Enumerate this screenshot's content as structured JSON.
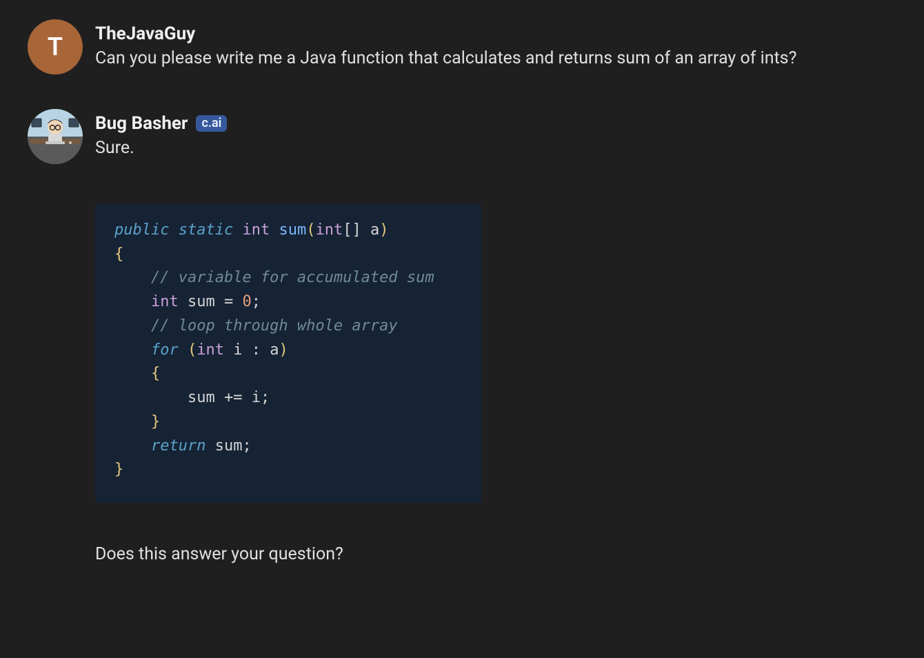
{
  "messages": [
    {
      "avatar_letter": "T",
      "username": "TheJavaGuy",
      "text": "Can you please write me a Java function that calculates and returns sum of an array of ints?"
    },
    {
      "username": "Bug Basher",
      "badge": "c.ai",
      "text_intro": "Sure.",
      "code": {
        "line1_kw1": "public",
        "line1_kw2": "static",
        "line1_type": "int",
        "line1_fn": "sum",
        "line1_paren_open": "(",
        "line1_param_type": "int",
        "line1_brackets": "[]",
        "line1_param_name": "a",
        "line1_paren_close": ")",
        "line2_brace": "{",
        "line3_comment": "// variable for accumulated sum",
        "line4_type": "int",
        "line4_name": "sum",
        "line4_eq": "=",
        "line4_zero": "0",
        "line4_semi": ";",
        "line5_comment": "// loop through whole array",
        "line6_for": "for",
        "line6_open": "(",
        "line6_type": "int",
        "line6_var": "i",
        "line6_colon": ":",
        "line6_arr": "a",
        "line6_close": ")",
        "line7_brace": "{",
        "line8_sum": "sum",
        "line8_op": "+=",
        "line8_i": "i",
        "line8_semi": ";",
        "line9_brace": "}",
        "line10_ret": "return",
        "line10_sum": "sum",
        "line10_semi": ";",
        "line11_brace": "}"
      },
      "followup": "Does this answer your question?"
    }
  ]
}
